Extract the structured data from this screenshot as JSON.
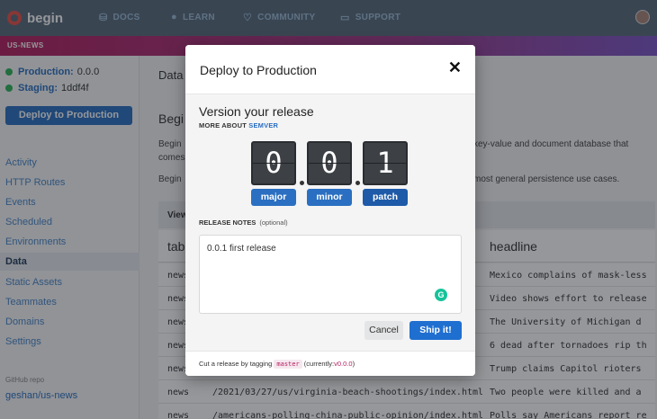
{
  "topnav": {
    "brand": "begin",
    "items": [
      {
        "label": "DOCS",
        "icon": "docs-icon"
      },
      {
        "label": "LEARN",
        "icon": "learn-icon"
      },
      {
        "label": "COMMUNITY",
        "icon": "heart-icon"
      },
      {
        "label": "SUPPORT",
        "icon": "chat-icon"
      }
    ]
  },
  "subbar": {
    "app_name": "US-NEWS"
  },
  "sidebar": {
    "production_label": "Production:",
    "production_value": "0.0.0",
    "staging_label": "Staging:",
    "staging_value": "1ddf4f",
    "deploy_button": "Deploy to Production",
    "links": [
      "Activity",
      "HTTP Routes",
      "Events",
      "Scheduled",
      "Environments",
      "Data",
      "Static Assets",
      "Teammates",
      "Domains",
      "Settings"
    ],
    "active_link": "Data",
    "github_label": "GitHub repo",
    "github_repo": "geshan/us-news"
  },
  "main": {
    "title": "Data",
    "heading": "Begi",
    "text1a": "Begin",
    "text1b": "key-value and document database that",
    "text2": "comes",
    "text3a": "Begin",
    "text3b": "most general persistence use cases.",
    "view_label": "View",
    "col_table": "tab",
    "col_headline": "headline",
    "rows": [
      {
        "table": "news",
        "key": "",
        "headline": "Mexico complains of mask-less"
      },
      {
        "table": "news",
        "key": "",
        "headline": "Video shows effort to release"
      },
      {
        "table": "news",
        "key": "",
        "headline": "The University of Michigan d"
      },
      {
        "table": "news",
        "key": "",
        "headline": "6 dead after tornadoes rip th"
      },
      {
        "table": "news",
        "key": "",
        "headline": "Trump claims Capitol rioters"
      },
      {
        "table": "news",
        "key": "/2021/03/27/us/virginia-beach-shootings/index.html",
        "headline": "Two people were killed and a"
      },
      {
        "table": "news",
        "key": "/americans-polling-china-public-opinion/index.html",
        "headline": "Polls say Americans report re"
      }
    ]
  },
  "modal": {
    "title": "Deploy to Production",
    "close": "✕",
    "version_title": "Version your release",
    "more_about": "MORE ABOUT",
    "semver_link": "SEMVER",
    "digits": [
      "0",
      "0",
      "1"
    ],
    "buttons": {
      "major": "major",
      "minor": "minor",
      "patch": "patch"
    },
    "selected": "patch",
    "release_notes_label": "RELEASE NOTES",
    "release_notes_optional": "(optional)",
    "release_notes_value": "0.0.1 first release",
    "grammarly": "G",
    "cancel": "Cancel",
    "ship": "Ship it!",
    "footer_prefix": "Cut a release by tagging",
    "footer_tag": "master",
    "footer_current_prefix": "(currently:",
    "footer_current_version": "v0.0.0",
    "footer_current_suffix": ")"
  },
  "colors": {
    "nav_bg": "#5a6a7c",
    "accent_blue": "#2a6fc1",
    "brand_red": "#e8504a",
    "magenta": "#b5205f",
    "status_green": "#2eb45a"
  }
}
